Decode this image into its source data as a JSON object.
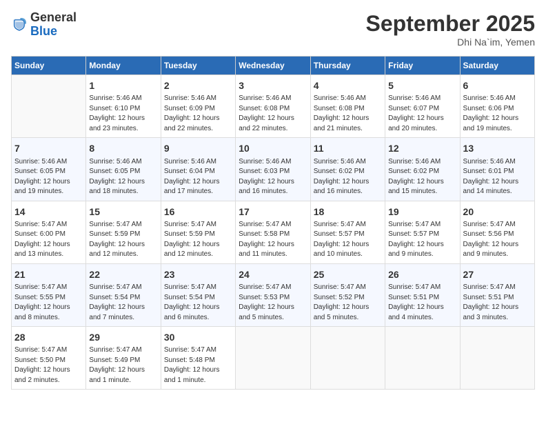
{
  "logo": {
    "line1": "General",
    "line2": "Blue"
  },
  "title": "September 2025",
  "location": "Dhi Na`im, Yemen",
  "columns": [
    "Sunday",
    "Monday",
    "Tuesday",
    "Wednesday",
    "Thursday",
    "Friday",
    "Saturday"
  ],
  "weeks": [
    [
      {
        "day": "",
        "info": ""
      },
      {
        "day": "1",
        "info": "Sunrise: 5:46 AM\nSunset: 6:10 PM\nDaylight: 12 hours\nand 23 minutes."
      },
      {
        "day": "2",
        "info": "Sunrise: 5:46 AM\nSunset: 6:09 PM\nDaylight: 12 hours\nand 22 minutes."
      },
      {
        "day": "3",
        "info": "Sunrise: 5:46 AM\nSunset: 6:08 PM\nDaylight: 12 hours\nand 22 minutes."
      },
      {
        "day": "4",
        "info": "Sunrise: 5:46 AM\nSunset: 6:08 PM\nDaylight: 12 hours\nand 21 minutes."
      },
      {
        "day": "5",
        "info": "Sunrise: 5:46 AM\nSunset: 6:07 PM\nDaylight: 12 hours\nand 20 minutes."
      },
      {
        "day": "6",
        "info": "Sunrise: 5:46 AM\nSunset: 6:06 PM\nDaylight: 12 hours\nand 19 minutes."
      }
    ],
    [
      {
        "day": "7",
        "info": "Sunrise: 5:46 AM\nSunset: 6:05 PM\nDaylight: 12 hours\nand 19 minutes."
      },
      {
        "day": "8",
        "info": "Sunrise: 5:46 AM\nSunset: 6:05 PM\nDaylight: 12 hours\nand 18 minutes."
      },
      {
        "day": "9",
        "info": "Sunrise: 5:46 AM\nSunset: 6:04 PM\nDaylight: 12 hours\nand 17 minutes."
      },
      {
        "day": "10",
        "info": "Sunrise: 5:46 AM\nSunset: 6:03 PM\nDaylight: 12 hours\nand 16 minutes."
      },
      {
        "day": "11",
        "info": "Sunrise: 5:46 AM\nSunset: 6:02 PM\nDaylight: 12 hours\nand 16 minutes."
      },
      {
        "day": "12",
        "info": "Sunrise: 5:46 AM\nSunset: 6:02 PM\nDaylight: 12 hours\nand 15 minutes."
      },
      {
        "day": "13",
        "info": "Sunrise: 5:46 AM\nSunset: 6:01 PM\nDaylight: 12 hours\nand 14 minutes."
      }
    ],
    [
      {
        "day": "14",
        "info": "Sunrise: 5:47 AM\nSunset: 6:00 PM\nDaylight: 12 hours\nand 13 minutes."
      },
      {
        "day": "15",
        "info": "Sunrise: 5:47 AM\nSunset: 5:59 PM\nDaylight: 12 hours\nand 12 minutes."
      },
      {
        "day": "16",
        "info": "Sunrise: 5:47 AM\nSunset: 5:59 PM\nDaylight: 12 hours\nand 12 minutes."
      },
      {
        "day": "17",
        "info": "Sunrise: 5:47 AM\nSunset: 5:58 PM\nDaylight: 12 hours\nand 11 minutes."
      },
      {
        "day": "18",
        "info": "Sunrise: 5:47 AM\nSunset: 5:57 PM\nDaylight: 12 hours\nand 10 minutes."
      },
      {
        "day": "19",
        "info": "Sunrise: 5:47 AM\nSunset: 5:57 PM\nDaylight: 12 hours\nand 9 minutes."
      },
      {
        "day": "20",
        "info": "Sunrise: 5:47 AM\nSunset: 5:56 PM\nDaylight: 12 hours\nand 9 minutes."
      }
    ],
    [
      {
        "day": "21",
        "info": "Sunrise: 5:47 AM\nSunset: 5:55 PM\nDaylight: 12 hours\nand 8 minutes."
      },
      {
        "day": "22",
        "info": "Sunrise: 5:47 AM\nSunset: 5:54 PM\nDaylight: 12 hours\nand 7 minutes."
      },
      {
        "day": "23",
        "info": "Sunrise: 5:47 AM\nSunset: 5:54 PM\nDaylight: 12 hours\nand 6 minutes."
      },
      {
        "day": "24",
        "info": "Sunrise: 5:47 AM\nSunset: 5:53 PM\nDaylight: 12 hours\nand 5 minutes."
      },
      {
        "day": "25",
        "info": "Sunrise: 5:47 AM\nSunset: 5:52 PM\nDaylight: 12 hours\nand 5 minutes."
      },
      {
        "day": "26",
        "info": "Sunrise: 5:47 AM\nSunset: 5:51 PM\nDaylight: 12 hours\nand 4 minutes."
      },
      {
        "day": "27",
        "info": "Sunrise: 5:47 AM\nSunset: 5:51 PM\nDaylight: 12 hours\nand 3 minutes."
      }
    ],
    [
      {
        "day": "28",
        "info": "Sunrise: 5:47 AM\nSunset: 5:50 PM\nDaylight: 12 hours\nand 2 minutes."
      },
      {
        "day": "29",
        "info": "Sunrise: 5:47 AM\nSunset: 5:49 PM\nDaylight: 12 hours\nand 1 minute."
      },
      {
        "day": "30",
        "info": "Sunrise: 5:47 AM\nSunset: 5:48 PM\nDaylight: 12 hours\nand 1 minute."
      },
      {
        "day": "",
        "info": ""
      },
      {
        "day": "",
        "info": ""
      },
      {
        "day": "",
        "info": ""
      },
      {
        "day": "",
        "info": ""
      }
    ]
  ]
}
